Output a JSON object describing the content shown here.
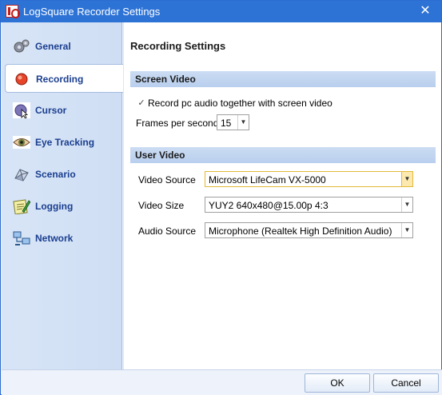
{
  "window": {
    "title": "LogSquare Recorder Settings"
  },
  "sidebar": {
    "items": [
      {
        "label": "General",
        "icon": "gears-icon"
      },
      {
        "label": "Recording",
        "icon": "record-icon"
      },
      {
        "label": "Cursor",
        "icon": "cursor-icon"
      },
      {
        "label": "Eye Tracking",
        "icon": "eye-icon"
      },
      {
        "label": "Scenario",
        "icon": "scenario-icon"
      },
      {
        "label": "Logging",
        "icon": "log-icon"
      },
      {
        "label": "Network",
        "icon": "network-icon"
      }
    ],
    "active": "Recording"
  },
  "main": {
    "title": "Recording Settings",
    "screen_video": {
      "header": "Screen Video",
      "record_audio_label": "Record pc audio together with screen video",
      "record_audio_checked": true,
      "fps_label": "Frames per second",
      "fps_value": "15"
    },
    "user_video": {
      "header": "User Video",
      "video_source_label": "Video Source",
      "video_source_value": "Microsoft LifeCam VX-5000",
      "video_size_label": "Video Size",
      "video_size_value": "YUY2 640x480@15.00p 4:3",
      "audio_source_label": "Audio Source",
      "audio_source_value": "Microphone (Realtek High Definition Audio)"
    }
  },
  "footer": {
    "ok_label": "OK",
    "cancel_label": "Cancel"
  },
  "colors": {
    "titlebar": "#2d73d6",
    "nav_text": "#1b3f8f",
    "section_header": "#c4d7f0"
  }
}
